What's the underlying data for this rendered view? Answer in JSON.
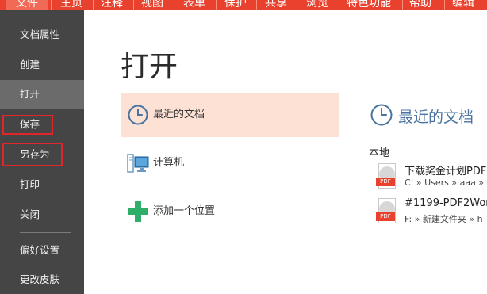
{
  "menu": {
    "items": [
      {
        "label": "文件"
      },
      {
        "label": "主页"
      },
      {
        "label": "注释"
      },
      {
        "label": "视图"
      },
      {
        "label": "表单"
      },
      {
        "label": "保护"
      },
      {
        "label": "共享"
      },
      {
        "label": "浏览"
      },
      {
        "label": "特色功能"
      },
      {
        "label": "帮助"
      },
      {
        "label": "编辑"
      }
    ],
    "active_index": 0
  },
  "sidebar": {
    "items": [
      {
        "label": "文档属性"
      },
      {
        "label": "创建"
      },
      {
        "label": "打开"
      },
      {
        "label": "保存"
      },
      {
        "label": "另存为"
      },
      {
        "label": "打印"
      },
      {
        "label": "关闭"
      },
      {
        "label": "偏好设置"
      },
      {
        "label": "更改皮肤"
      }
    ],
    "selected_index": 2,
    "highlighted": [
      "保存",
      "另存为"
    ]
  },
  "main": {
    "title": "打开",
    "places": [
      {
        "label": "最近的文档",
        "icon": "clock-icon"
      },
      {
        "label": "计算机",
        "icon": "computer-icon"
      },
      {
        "label": "添加一个位置",
        "icon": "plus-icon"
      }
    ],
    "selected_place": 0
  },
  "recent": {
    "title": "最近的文档",
    "section_label": "本地",
    "files": [
      {
        "name": "下载奖金计划PDF",
        "path": "C: » Users » aaa »",
        "icon": "pdf-file-icon"
      },
      {
        "name": "#1199-PDF2Wor",
        "path": "F: » 新建文件夹 » h",
        "icon": "pdf-file-icon"
      }
    ]
  },
  "colors": {
    "menubar": "#e8412d",
    "sidebar": "#454545",
    "sidebar_selected": "#6b6b6b",
    "place_selected": "#fde1d5",
    "accent_blue": "#4a74a0",
    "highlight_box": "#e0262b",
    "plus_green": "#2fae6a"
  }
}
